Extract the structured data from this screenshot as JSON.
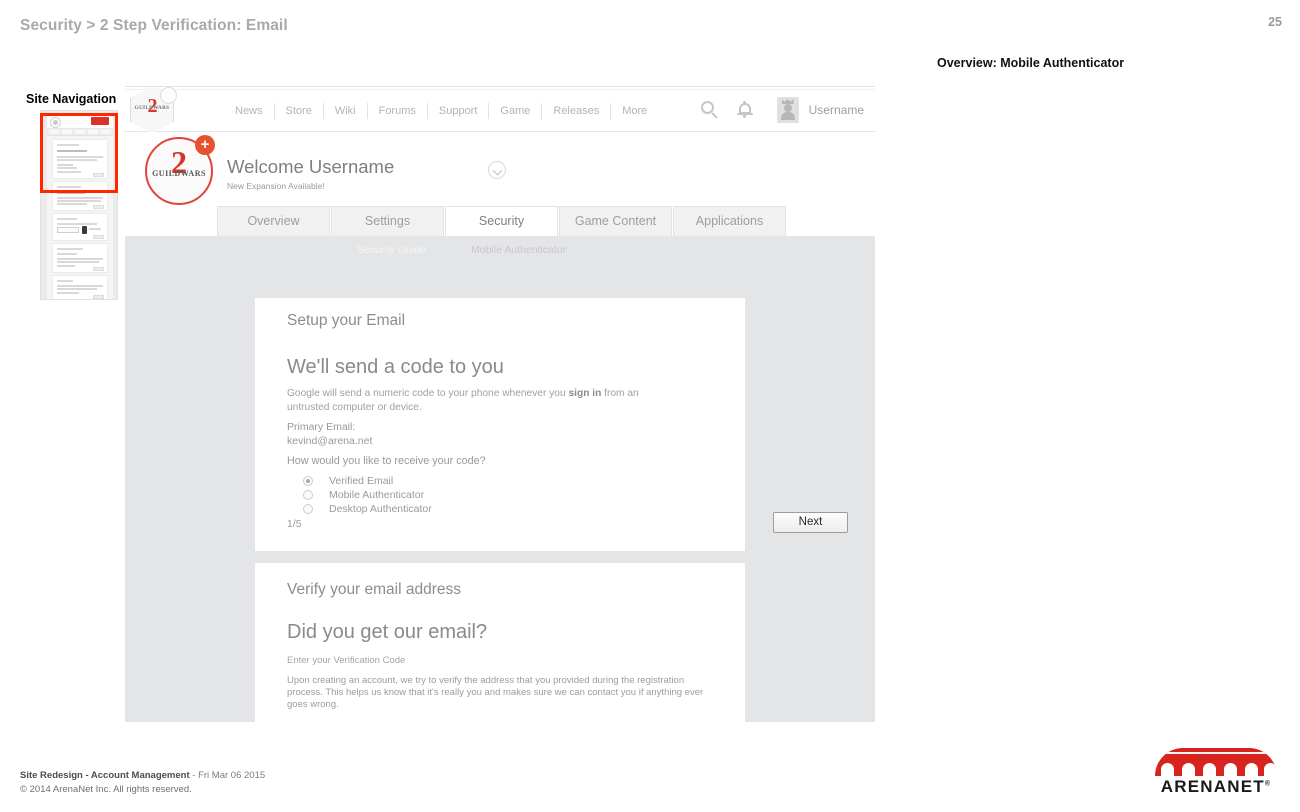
{
  "slide": {
    "title": "Security > 2 Step Verification: Email",
    "page_number": "25",
    "annotation": "Overview: Mobile Authenticator"
  },
  "site_navigation": {
    "label": "Site Navigation"
  },
  "browser": {
    "topnav": {
      "logo_word": "GUILDWARS",
      "logo_glyph": "2",
      "links": [
        {
          "label": "News"
        },
        {
          "label": "Store"
        },
        {
          "label": "Wiki"
        },
        {
          "label": "Forums"
        },
        {
          "label": "Support"
        },
        {
          "label": "Game"
        },
        {
          "label": "Releases"
        },
        {
          "label": "More"
        }
      ],
      "search_icon": "search-icon",
      "bell_icon": "notification-bell-icon",
      "avatar_icon": "user-avatar-icon",
      "username": "Username"
    },
    "welcome": {
      "logo_word": "GUILDWARS",
      "logo_glyph": "2",
      "plus_badge": "+",
      "title": "Welcome Username",
      "subtitle": "New Expansion Available!",
      "chevron_icon": "chevron-down-icon"
    },
    "tabs": [
      {
        "label": "Overview",
        "active": false
      },
      {
        "label": "Settings",
        "active": false
      },
      {
        "label": "Security",
        "active": true
      },
      {
        "label": "Game Content",
        "active": false
      },
      {
        "label": "Applications",
        "active": false
      }
    ],
    "subtabs": [
      {
        "label": "Security Guide",
        "active": true
      },
      {
        "label": "Mobile Authenticator",
        "active": false
      }
    ],
    "card_setup_email": {
      "kicker": "Setup your Email",
      "heading": "We'll send a code to you",
      "paragraph_pre": "Google will send a numeric code to your phone whenever you ",
      "paragraph_bold": "sign in",
      "paragraph_post": " from an untrusted computer or device.",
      "email_label": "Primary Email:",
      "email_value": "kevind@arena.net",
      "question": "How would you like to receive your code?",
      "options": [
        {
          "label": "Verified Email",
          "selected": true
        },
        {
          "label": "Mobile Authenticator",
          "selected": false
        },
        {
          "label": "Desktop Authenticator",
          "selected": false
        }
      ],
      "step_counter": "1/5",
      "next_label": "Next"
    },
    "card_verify_email": {
      "kicker": "Verify your email address",
      "heading": "Did you get our email?",
      "subheading": "Enter your Verification Code",
      "paragraph": "Upon creating an account, we try to verify the address that you provided during the registration process.  This helps us know that it's really you and makes sure we can contact you if anything ever goes wrong."
    }
  },
  "footer": {
    "project": "Site Redesign - Account Management",
    "separator": " - ",
    "date": "Fri Mar 06 2015",
    "copyright": "© 2014 ArenaNet Inc. All rights reserved.",
    "logo_text": "ARENANET",
    "logo_mark": "®"
  },
  "colors": {
    "brand_red": "#d8241f",
    "gw2_red": "#d8352a",
    "highlight_red": "#ff2600",
    "page_gray": "#e4e5e7",
    "text_gray": "#9a9a9a"
  }
}
